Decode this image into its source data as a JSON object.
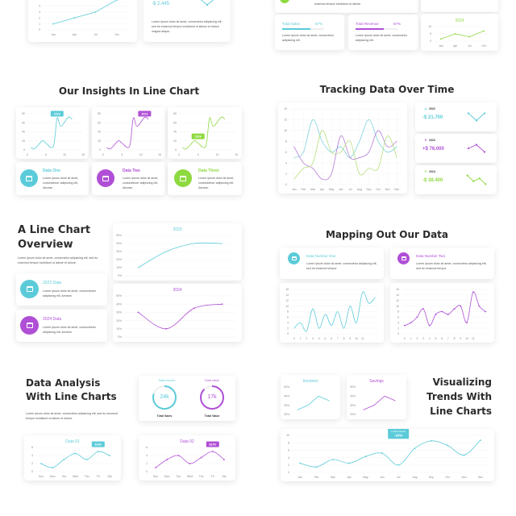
{
  "colors": {
    "teal": "#5bcbd9",
    "purple": "#b04fd6",
    "green": "#8ed93f",
    "text": "#2b2b2b"
  },
  "lorem_short": "Lorem ipsum dolor sit amet, consectetuer adipiscing elit. Aenean",
  "lorem_long": "Lorem ipsum dolor sit amet, consectetur adipiscing elit, sed do eiusmod tempor incididunt ut labore et dolore.",
  "top": {
    "value": "-$ 2,445",
    "value_text": "Lorem ipsum dolor sit amet, consectetur adipiscing elit, sed do eiusmod tempor incididunt ut labore et dolore magna aliqua.",
    "partial_text": "eiusmod tempor incididunt ut labore.",
    "total_sales": {
      "label": "Total Sales",
      "percent": "67%",
      "fill": 0.67,
      "text": "Lorem ipsum dolor sit amet, consectetur adipiscing elit."
    },
    "total_revenue": {
      "label": "Total Revenue",
      "percent": "67%",
      "fill": 0.67,
      "text": "Lorem ipsum dolor sit amet, consectetur adipiscing elit."
    }
  },
  "insights": {
    "title": "Our Insights In Line Chart",
    "items": [
      {
        "label": "Data One",
        "text": "Lorem ipsum dolor sit amet, consectetuer adipiscing elit. Aenean"
      },
      {
        "label": "Data Two",
        "text": "Lorem ipsum dolor sit amet, consectetuer adipiscing elit. Aenean"
      },
      {
        "label": "Data Three",
        "text": "Lorem ipsum dolor sit amet, consectetuer adipiscing elit. Aenean"
      }
    ]
  },
  "tracking": {
    "title": "Tracking Data Over Time",
    "items": [
      {
        "year": "2022",
        "value": "-$ 21.700",
        "icon": "triangle-up"
      },
      {
        "year": "2023",
        "value": "+$ 76.000",
        "icon": "triangle-down"
      },
      {
        "year": "2024",
        "value": "-$ 38.400",
        "icon": "triangle-down"
      }
    ]
  },
  "overview": {
    "title_line1": "A Line Chart",
    "title_line2": "Overview",
    "text": "Lorem ipsum dolor sit amet, consectetur adipiscing elit, sed do eiusmod tempor incididunt ut labore et dolore.",
    "items": [
      {
        "label": "2023 Data",
        "text": "Lorem ipsum dolor sit amet, consectetuer adipiscing elit. Aenean"
      },
      {
        "label": "2024 Data",
        "text": "Lorem ipsum dolor sit amet, consectetuer adipiscing elit. Aenean"
      }
    ]
  },
  "mapping": {
    "title": "Mapping Out Our Data",
    "items": [
      {
        "label": "Data Number One",
        "text": "Lorem ipsum dolor sit amet, consectetur adipiscing elit, sed do eiusmod tempor"
      },
      {
        "label": "Data Number Two",
        "text": "Lorem ipsum dolor sit amet, consectetur adipiscing elit, sed do eiusmod tempor"
      }
    ]
  },
  "analysis": {
    "title_line1": "Data Analysis",
    "title_line2": "With Line Charts",
    "text": "Lorem ipsum dolor sit amet, consectetur adipiscing elit, sed do eiusmod tempor incididunt ut labore et dolore.",
    "gauges": [
      {
        "label": "Data Income",
        "value": "24k",
        "caption": "Total Sales",
        "fill": 0.8
      },
      {
        "label": "Data Value",
        "value": "17k",
        "caption": "Total Value",
        "fill": 0.88
      }
    ]
  },
  "trends": {
    "title_line1": "Visualizing",
    "title_line2": "Trends With",
    "title_line3": "Line Charts"
  },
  "chart_data": [
    {
      "type": "line",
      "x": [
        "Jan",
        "Apr",
        "Jul",
        "Oct"
      ],
      "series": [
        {
          "values": [
            1,
            2,
            3,
            5
          ],
          "color": "#5bcbd9"
        }
      ],
      "yticks": [
        0,
        1,
        2,
        3,
        4
      ],
      "ylim": [
        0,
        5
      ],
      "markers": true
    },
    {
      "type": "line",
      "title": "2024",
      "x": [
        "Jan",
        "Apr",
        "Jul",
        "Oct"
      ],
      "series": [
        {
          "values": [
            1.5,
            5,
            3,
            7
          ],
          "color": "#8ed93f"
        }
      ],
      "yticks": [
        0,
        5,
        10
      ],
      "ylim": [
        0,
        10
      ],
      "markers": true
    },
    {
      "type": "line",
      "x": [
        1,
        2,
        4,
        5,
        7,
        8,
        9,
        11,
        12
      ],
      "xticks": [
        0,
        5,
        10,
        15
      ],
      "xlim": [
        0,
        15
      ],
      "series": [
        {
          "values": [
            5,
            3,
            20,
            15,
            8,
            70,
            52,
            72,
            68
          ],
          "color": "#5bcbd9"
        }
      ],
      "yticks": [
        0,
        20,
        40,
        60,
        80
      ],
      "ylim": [
        0,
        80
      ],
      "smooth": true,
      "annotation": {
        "label": "2023",
        "x": 8,
        "y": 80
      }
    },
    {
      "type": "line",
      "x": [
        1,
        2,
        4,
        5,
        7,
        8,
        9,
        11,
        12
      ],
      "xticks": [
        0,
        5,
        10,
        15
      ],
      "xlim": [
        0,
        15
      ],
      "series": [
        {
          "values": [
            5,
            3,
            20,
            15,
            8,
            70,
            52,
            72,
            68
          ],
          "color": "#b04fd6"
        }
      ],
      "yticks": [
        0,
        20,
        40,
        60,
        80
      ],
      "ylim": [
        0,
        80
      ],
      "smooth": true,
      "annotation": {
        "label": "2023",
        "x": 11,
        "y": 80
      }
    },
    {
      "type": "line",
      "x": [
        1,
        2,
        4,
        5,
        7,
        8,
        9,
        11,
        12
      ],
      "xticks": [
        0,
        5,
        10,
        15
      ],
      "xlim": [
        0,
        15
      ],
      "series": [
        {
          "values": [
            5,
            3,
            20,
            15,
            8,
            70,
            52,
            72,
            68
          ],
          "color": "#8ed93f"
        }
      ],
      "yticks": [
        0,
        20,
        40,
        60,
        80
      ],
      "ylim": [
        0,
        80
      ],
      "smooth": true,
      "annotation": {
        "label": "2024",
        "x": 5,
        "y": 30
      }
    },
    {
      "type": "line",
      "x": [
        "Jan",
        "Feb",
        "Mar",
        "Apr",
        "May",
        "Jun",
        "Jul",
        "Aug",
        "Sep",
        "Oct",
        "Nov",
        "Dec"
      ],
      "series": [
        {
          "values": [
            5,
            6,
            12,
            8,
            6,
            7,
            5,
            8,
            12,
            8,
            6,
            7
          ],
          "color": "#7fd3dd"
        },
        {
          "values": [
            7,
            4,
            3,
            1,
            2,
            9,
            5,
            5,
            6,
            10,
            7,
            8
          ],
          "color": "#b77fd6"
        },
        {
          "values": [
            1,
            3,
            4,
            10,
            6,
            6,
            8,
            2,
            3,
            3,
            9,
            5
          ],
          "color": "#b6e07f"
        }
      ],
      "yticks": [
        0,
        2,
        4,
        6,
        8,
        10,
        12,
        14
      ],
      "ylim": [
        0,
        14
      ],
      "smooth": true,
      "grid_vertical": true
    },
    {
      "type": "line",
      "x": [
        0,
        1,
        2
      ],
      "series": [
        {
          "values": [
            3,
            1,
            3
          ],
          "color": "#5bcbd9"
        }
      ],
      "ylim": [
        0,
        4
      ],
      "markers": true,
      "bare": true
    },
    {
      "type": "line",
      "x": [
        0,
        1,
        2
      ],
      "series": [
        {
          "values": [
            2,
            3,
            1
          ],
          "color": "#b04fd6"
        }
      ],
      "ylim": [
        0,
        4
      ],
      "markers": true,
      "bare": true
    },
    {
      "type": "line",
      "x": [
        0,
        1,
        2,
        3
      ],
      "series": [
        {
          "values": [
            3,
            1,
            2,
            0
          ],
          "color": "#8ed93f"
        }
      ],
      "ylim": [
        -1,
        4
      ],
      "markers": true,
      "bare": true
    },
    {
      "type": "line",
      "title": "2023",
      "x": [
        "Q1",
        "Q2",
        "Q3",
        "Q4"
      ],
      "hide_xlabels": true,
      "series": [
        {
          "values": [
            10,
            30,
            40,
            40
          ],
          "color": "#5bcbd9"
        }
      ],
      "yticks": [
        "0%",
        "10%",
        "20%",
        "30%",
        "40%",
        "50%"
      ],
      "ylim": [
        0,
        50
      ],
      "smooth": true
    },
    {
      "type": "line",
      "title": "2024",
      "x": [
        "Q1",
        "Q2",
        "Q3",
        "Q4"
      ],
      "hide_xlabels": true,
      "series": [
        {
          "values": [
            30,
            10,
            35,
            40
          ],
          "color": "#b04fd6"
        }
      ],
      "yticks": [
        "0%",
        "10%",
        "20%",
        "30%",
        "40%",
        "50%"
      ],
      "ylim": [
        0,
        50
      ],
      "smooth": true,
      "markers": true
    },
    {
      "type": "line",
      "x": [
        0,
        1,
        2,
        3,
        4,
        5,
        6,
        7,
        8,
        9,
        10,
        11,
        12,
        13
      ],
      "xticks": [
        0,
        1,
        2,
        3,
        4,
        5,
        6,
        7,
        8,
        9,
        10,
        11
      ],
      "xlim": [
        -0.5,
        13.5
      ],
      "series": [
        {
          "values": [
            2,
            4,
            1,
            9,
            2,
            7,
            3,
            8,
            2,
            10,
            4,
            15,
            11,
            13
          ],
          "color": "#5bcbd9"
        }
      ],
      "yticks": [
        0,
        2,
        4,
        6,
        8,
        10,
        12,
        14,
        16
      ],
      "ylim": [
        0,
        16
      ],
      "smooth": true
    },
    {
      "type": "line",
      "x": [
        0,
        1,
        2,
        3,
        4,
        5,
        6,
        7,
        8,
        9,
        10,
        11,
        12,
        13
      ],
      "xticks": [
        0,
        1,
        2,
        3,
        4,
        5,
        6,
        7,
        8,
        9,
        10,
        11
      ],
      "xlim": [
        -0.5,
        13.5
      ],
      "series": [
        {
          "values": [
            3,
            4,
            6,
            9,
            3,
            7,
            8,
            7,
            9,
            10,
            4,
            15,
            10,
            8
          ],
          "color": "#b04fd6"
        }
      ],
      "yticks": [
        0,
        2,
        4,
        6,
        8,
        10,
        12,
        14,
        16
      ],
      "ylim": [
        0,
        16
      ],
      "smooth": true,
      "markers": true
    },
    {
      "type": "line",
      "title": "Data 01",
      "x": [
        "Sun",
        "Mon",
        "Tue",
        "Wed",
        "Thu",
        "Fri",
        "Sat"
      ],
      "series": [
        {
          "values": [
            2,
            1,
            3,
            4.5,
            3,
            5,
            4
          ],
          "color": "#5bcbd9"
        }
      ],
      "yticks": [
        0,
        2,
        4,
        6
      ],
      "ylim": [
        0,
        6
      ],
      "smooth": true,
      "markers": true,
      "annotation": {
        "label": "$24K",
        "x": "Fri",
        "y": 6.8
      }
    },
    {
      "type": "line",
      "title": "Data 02",
      "x": [
        "Sun",
        "Mon",
        "Tue",
        "Wed",
        "Thu",
        "Fri",
        "Sat"
      ],
      "series": [
        {
          "values": [
            1,
            3,
            4,
            2,
            3.5,
            5,
            3
          ],
          "color": "#b04fd6"
        }
      ],
      "yticks": [
        0,
        2,
        4,
        6
      ],
      "ylim": [
        0,
        6
      ],
      "smooth": true,
      "markers": true,
      "annotation": {
        "label": "$17K",
        "x": "Fri",
        "y": 6.8
      }
    },
    {
      "type": "line",
      "title": "Incomes",
      "x": [
        "Q1",
        "Q2",
        "Q3",
        "Q4"
      ],
      "hide_xlabels": true,
      "series": [
        {
          "values": [
            25,
            30,
            40,
            35
          ],
          "color": "#5bcbd9"
        }
      ],
      "yticks": [
        "20%",
        "30%",
        "40%",
        "50%"
      ],
      "ylim": [
        20,
        50
      ],
      "ytick_values": [
        20,
        30,
        40,
        50
      ],
      "nogrid": true
    },
    {
      "type": "line",
      "title": "Savings",
      "x": [
        "Q1",
        "Q2",
        "Q3",
        "Q4"
      ],
      "hide_xlabels": true,
      "series": [
        {
          "values": [
            25,
            30,
            40,
            35
          ],
          "color": "#b04fd6"
        }
      ],
      "yticks": [
        "20%",
        "30%",
        "40%",
        "50%"
      ],
      "ylim": [
        20,
        50
      ],
      "ytick_values": [
        20,
        30,
        40,
        50
      ],
      "nogrid": true
    },
    {
      "type": "line",
      "x": [
        "Jan",
        "Feb",
        "Mar",
        "Apr",
        "May",
        "Jun",
        "Jul",
        "Aug",
        "Sep",
        "Oct",
        "Nov",
        "Dec"
      ],
      "series": [
        {
          "values": [
            2.5,
            1.5,
            3.5,
            2.5,
            4.3,
            5.2,
            2,
            6.5,
            8.5,
            7.3,
            4.7,
            8.7
          ],
          "color": "#5bcbd9"
        }
      ],
      "yticks": [
        0,
        2,
        4,
        6,
        8,
        10
      ],
      "ylim": [
        0,
        10
      ],
      "smooth": true,
      "markers": true,
      "annotation": {
        "label": "-10%",
        "sublabel": "Lowest Result",
        "x": "Jul",
        "y": 10.5,
        "big": true
      }
    }
  ]
}
